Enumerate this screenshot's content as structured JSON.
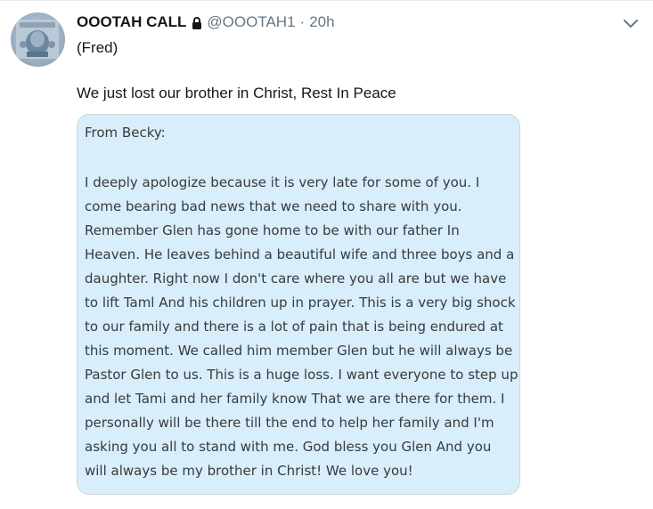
{
  "tweet": {
    "author_name": "OOOTAH CALL",
    "handle": "@OOOTAH1",
    "separator": "·",
    "timestamp": "20h",
    "text_line_1": "(Fred)",
    "text_line_2": "We just lost our brother in Christ, Rest In Peace",
    "icons": {
      "lock": "lock-icon",
      "menu": "chevron-down-icon",
      "avatar": "avatar-image"
    }
  },
  "card": {
    "heading": "From Becky:",
    "lines": [
      "I deeply apologize because it is very late for some of you. I",
      "come bearing bad news that we need to share with you.",
      "Remember Glen has gone home to be with our father In",
      "Heaven. He leaves behind a beautiful wife and three boys and a",
      "daughter. Right now I don't care where you all are but we have",
      "to lift Taml And his children up in prayer. This is a very big shock",
      "to our family and there is a lot of pain that is being endured at",
      "this moment. We called him member Glen but he will always be",
      "Pastor Glen to us. This is a huge loss. I want everyone to step up",
      "and let Tami and her family know That we are there for them. I",
      "personally will be there till the end to help her family and I'm",
      "asking you all to stand with me. God bless you Glen And you",
      "will always be my brother in Christ! We love you!"
    ]
  },
  "colors": {
    "text": "#14171a",
    "secondary": "#657786",
    "card_bg": "#d8eefb",
    "card_border": "#ccd6dd"
  }
}
